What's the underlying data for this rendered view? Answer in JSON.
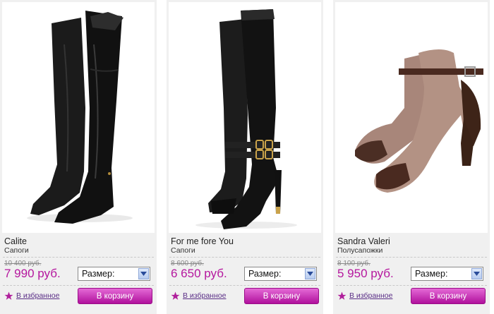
{
  "products": [
    {
      "brand": "Calite",
      "category": "Сапоги",
      "old_price": "10 400 руб.",
      "price": "7 990 руб.",
      "size_label": "Размер:",
      "favorite_label": "В избранное",
      "cart_label": "В корзину"
    },
    {
      "brand": "For me fore You",
      "category": "Сапоги",
      "old_price": "8 600 руб.",
      "price": "6 650 руб.",
      "size_label": "Размер:",
      "favorite_label": "В избранное",
      "cart_label": "В корзину"
    },
    {
      "brand": "Sandra Valeri",
      "category": "Полусапожки",
      "old_price": "8 100 руб.",
      "price": "5 950 руб.",
      "size_label": "Размер:",
      "favorite_label": "В избранное",
      "cart_label": "В корзину"
    }
  ],
  "colors": {
    "price": "#b5179e",
    "cart_button": "#c21aae",
    "favorite_star": "#b0209c",
    "card_bg": "#f0f0f0"
  },
  "icons": {
    "favorite": "star-icon",
    "select_arrow": "chevron-down-icon"
  }
}
